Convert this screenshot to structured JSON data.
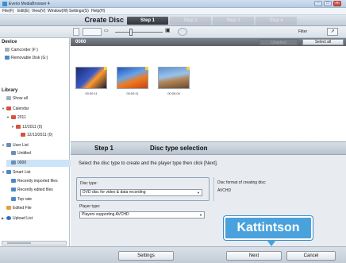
{
  "window": {
    "title": "Everio MediaBrowser 4"
  },
  "menu": [
    "File(F)",
    "Edit(E)",
    "View(V)",
    "Window(W)",
    "Settings(S)",
    "Help(H)"
  ],
  "header": {
    "title_left": "Create Di",
    "title_right": "sc",
    "steps": [
      {
        "label": "Step 1",
        "active": true
      },
      {
        "label": "Step 2",
        "active": false
      },
      {
        "label": "Step 3",
        "active": false
      },
      {
        "label": "Step 4",
        "active": false
      }
    ]
  },
  "toolbar": {
    "filter_label": "Filter",
    "filter_button": "↗"
  },
  "sidebar": {
    "device_heading": "Device",
    "devices": [
      "Camcorder (F:)",
      "Removable Disk (G:)"
    ],
    "library_heading": "Library",
    "library": [
      {
        "label": "Show all",
        "indent": 0,
        "icon": "grid-icon"
      },
      {
        "label": "Calendar",
        "indent": 0,
        "icon": "calendar-icon",
        "expander": "▼"
      },
      {
        "label": "2011",
        "indent": 1,
        "icon": "calendar-icon",
        "expander": "▼"
      },
      {
        "label": "12/2011 (0)",
        "indent": 2,
        "icon": "calendar-icon",
        "expander": "▼"
      },
      {
        "label": "12/13/2011 (0)",
        "indent": 3,
        "icon": "calendar-icon"
      },
      {
        "label": "User List",
        "indent": 0,
        "icon": "list-icon",
        "expander": "▼"
      },
      {
        "label": "Untitled",
        "indent": 1,
        "icon": "list-icon"
      },
      {
        "label": "0000",
        "indent": 1,
        "icon": "list-icon",
        "selected": true
      },
      {
        "label": "Smart List",
        "indent": 0,
        "icon": "smart-list-icon",
        "expander": "▼"
      },
      {
        "label": "Recently imported files",
        "indent": 1,
        "icon": "smart-list-icon"
      },
      {
        "label": "Recently edited files",
        "indent": 1,
        "icon": "smart-list-icon"
      },
      {
        "label": "Top rate",
        "indent": 1,
        "icon": "smart-list-icon"
      },
      {
        "label": "Edited File",
        "indent": 0,
        "icon": "star-icon"
      },
      {
        "label": "Upload List",
        "indent": 0,
        "icon": "upload-icon",
        "expander": "▶"
      }
    ]
  },
  "main": {
    "count": "0000",
    "unselect_label": "Unselect",
    "select_all_label": "Select all",
    "thumbnails": [
      {
        "caption": "00:00:11",
        "colors": [
          "#2c3f86",
          "#ff8f2b"
        ]
      },
      {
        "caption": "00:00:11",
        "colors": [
          "#2b62c4",
          "#f27024"
        ]
      },
      {
        "caption": "00:00:04",
        "colors": [
          "#4f86c6",
          "#a67f58"
        ]
      }
    ]
  },
  "wizard": {
    "step": "Step 1",
    "title": "Disc type selection",
    "instruction": "Select the disc type to create and the player type then click [Next].",
    "disc_type_label": "Disc type:",
    "disc_type_value": "DVD disc for video & data recording",
    "format_label": "Disc format of creating disc:",
    "format_value": "AVCHD",
    "player_type_label": "Player type:",
    "player_type_value": "Players supporting AVCHD"
  },
  "footer": {
    "settings_label": "Settings",
    "next_label": "Next",
    "cancel_label": "Cancel"
  },
  "callout": {
    "text": "Kattintson",
    "color": "#4aa2dd"
  }
}
